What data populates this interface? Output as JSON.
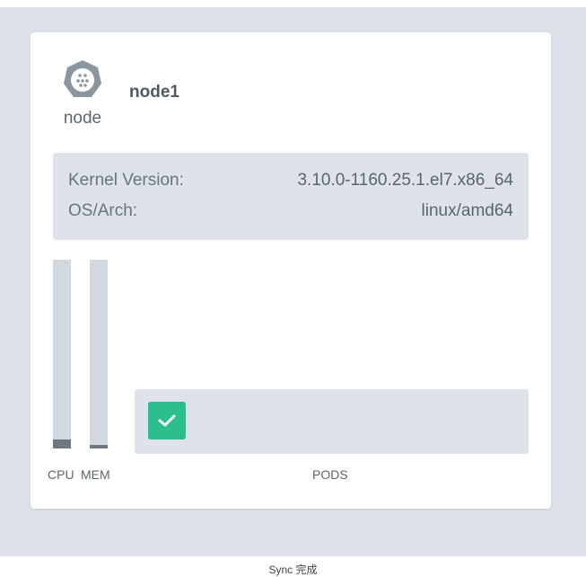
{
  "node": {
    "type_label": "node",
    "name": "node1",
    "icon": "kubernetes-node-icon"
  },
  "info": {
    "kernel_key": "Kernel Version:",
    "kernel_value": "3.10.0-1160.25.1.el7.x86_64",
    "os_key": "OS/Arch:",
    "os_value": "linux/amd64"
  },
  "usage": {
    "cpu_label": "CPU",
    "mem_label": "MEM",
    "cpu_fraction": 0.05,
    "mem_fraction": 0.02
  },
  "pods": {
    "label": "PODS",
    "items": [
      {
        "status": "running",
        "icon": "check-icon"
      }
    ]
  },
  "status_bar": {
    "text": "Sync 完成"
  },
  "colors": {
    "background": "#dde3e8",
    "card": "#ffffff",
    "pod_ok": "#2bbf8e",
    "bar_track": "#d2d9de",
    "bar_fill": "#6e7880",
    "icon": "#8c969e"
  }
}
